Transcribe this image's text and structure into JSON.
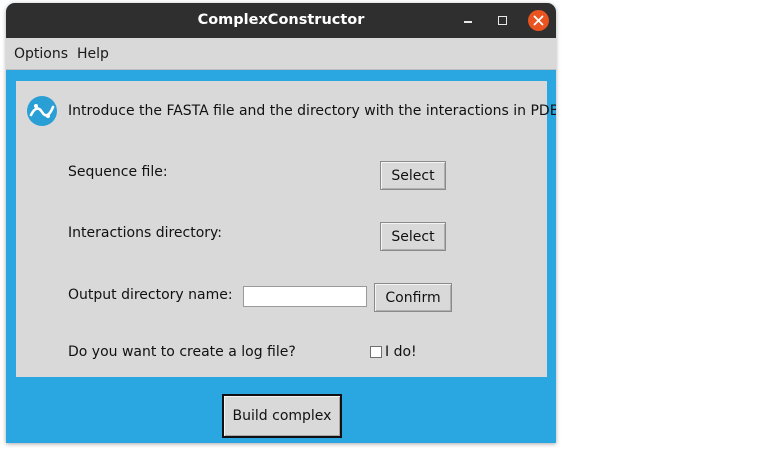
{
  "window": {
    "title": "ComplexConstructor",
    "controls": [
      "minimize-icon",
      "maximize-icon",
      "close-icon"
    ],
    "accent_color": "#2aa6e0",
    "close_color": "#e95420"
  },
  "menubar": {
    "items": [
      {
        "label": "Options"
      },
      {
        "label": "Help"
      }
    ]
  },
  "form": {
    "logo_icon": "dna-wave-icon",
    "intro": "Introduce the FASTA file and the directory with the interactions in PDB:",
    "sequence_label": "Sequence file:",
    "sequence_button": "Select",
    "interactions_label": "Interactions directory:",
    "interactions_button": "Select",
    "output_label": "Output directory name:",
    "output_value": "",
    "confirm_button": "Confirm",
    "log_label": "Do you want to create a log file?",
    "log_checkbox_label": "I do!",
    "log_checked": false
  },
  "footer": {
    "build_button": "Build complex"
  }
}
